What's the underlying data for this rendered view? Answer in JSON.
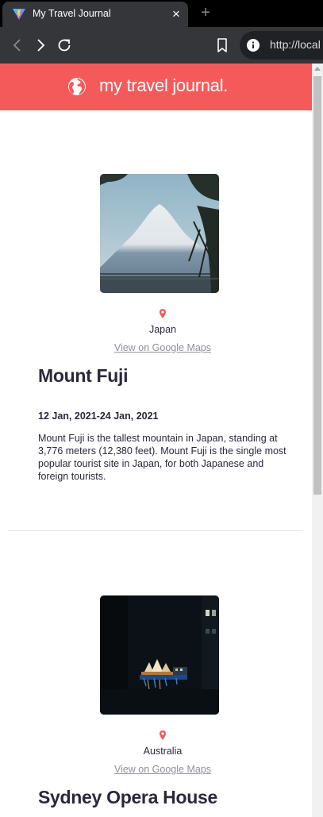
{
  "browser": {
    "tab_title": "My Travel Journal",
    "tab_close": "×",
    "new_tab": "+",
    "url_text": "http://local",
    "icons": [
      "vite-favicon-icon",
      "back-icon",
      "forward-icon",
      "reload-icon",
      "bookmark-icon",
      "info-icon"
    ]
  },
  "header": {
    "title": "my travel journal.",
    "icon": "globe-icon",
    "color": "#F55A5A"
  },
  "entries": [
    {
      "country": "Japan",
      "maps_link": "View on Google Maps",
      "title": "Mount Fuji",
      "dates": "12 Jan, 2021-24 Jan, 2021",
      "description": "Mount Fuji is the tallest mountain in Japan, standing at 3,776 meters (12,380 feet). Mount Fuji is the single most popular tourist site in Japan, for both Japanese and foreign tourists."
    },
    {
      "country": "Australia",
      "maps_link": "View on Google Maps",
      "title": "Sydney Opera House"
    }
  ]
}
